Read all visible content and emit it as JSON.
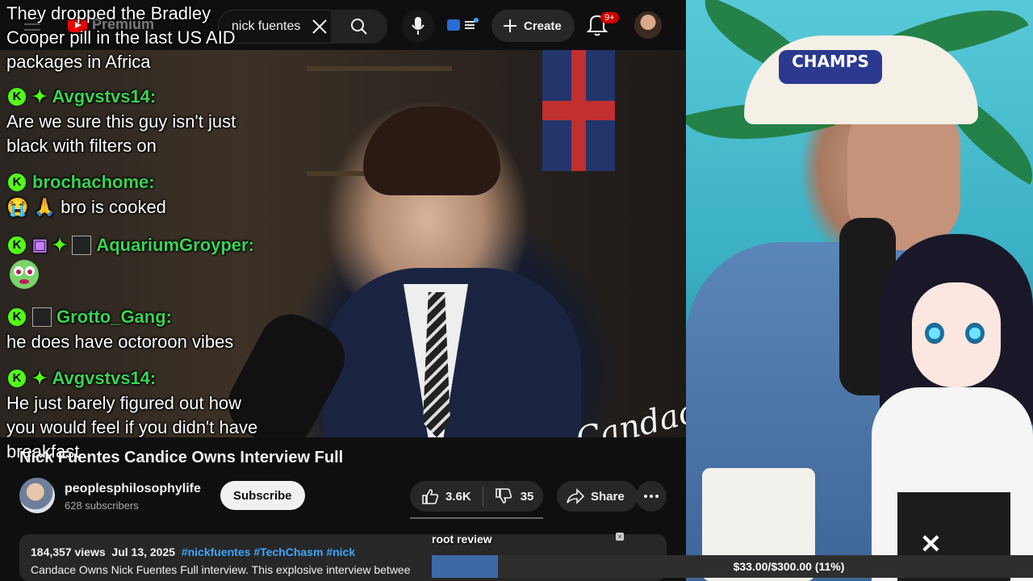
{
  "header": {
    "brand": "Premium",
    "search_value": "nick fuentes",
    "create_label": "Create",
    "notification_badge": "9+"
  },
  "chat": [
    {
      "user": "",
      "text_lines": [
        "They dropped the Bradley",
        "Cooper pill in the last US AID",
        "packages in Africa"
      ]
    },
    {
      "user": "Avgvstvs14:",
      "text_lines": [
        "Are we sure this guy isn't just",
        "black with filters on"
      ]
    },
    {
      "user": "brochachome:",
      "text_lines": [
        "bro is cooked"
      ]
    },
    {
      "user": "AquariumGroyper:",
      "text_lines": []
    },
    {
      "user": "Grotto_Gang:",
      "text_lines": [
        "he does have octoroon vibes"
      ]
    },
    {
      "user": "Avgvstvs14:",
      "text_lines": [
        "He just barely figured out how",
        "you would feel if you didn't have",
        "breakfast"
      ]
    }
  ],
  "video": {
    "watermark": "Candace",
    "title": "Nick Fuentes Candice Owns Interview Full"
  },
  "channel": {
    "name": "peoplesphilosophylife",
    "subscribers": "628 subscribers",
    "subscribe_label": "Subscribe"
  },
  "actions": {
    "likes": "3.6K",
    "dislikes": "35",
    "share_label": "Share"
  },
  "description": {
    "views": "184,357 views",
    "date": "Jul 13, 2025",
    "tags": [
      "#nickfuentes",
      "#TechChasm",
      "#nick"
    ],
    "snippet": "Candace Owns Nick Fuentes Full interview. This  explosive interview betwee"
  },
  "overlay": {
    "cap_text": "CHAMPS",
    "goal_label": "root review",
    "goal_progress_text": "$33.00/$300.00 (11%)",
    "goal_fraction": 0.11
  },
  "colors": {
    "kick_green": "#53fc18",
    "username_green": "#39d353",
    "link_blue": "#3ea6ff",
    "goal_fill": "#3d6aa7",
    "notification_red": "#cc0000"
  },
  "icons": [
    "menu-icon",
    "youtube-logo",
    "close-icon",
    "search-icon",
    "microphone-icon",
    "extension-icon",
    "plus-icon",
    "bell-icon",
    "thumbs-up-icon",
    "thumbs-down-icon",
    "share-icon",
    "more-icon",
    "kick-badge-icon",
    "sparkle-badge-icon",
    "gift-badge-icon",
    "emote-icon"
  ]
}
